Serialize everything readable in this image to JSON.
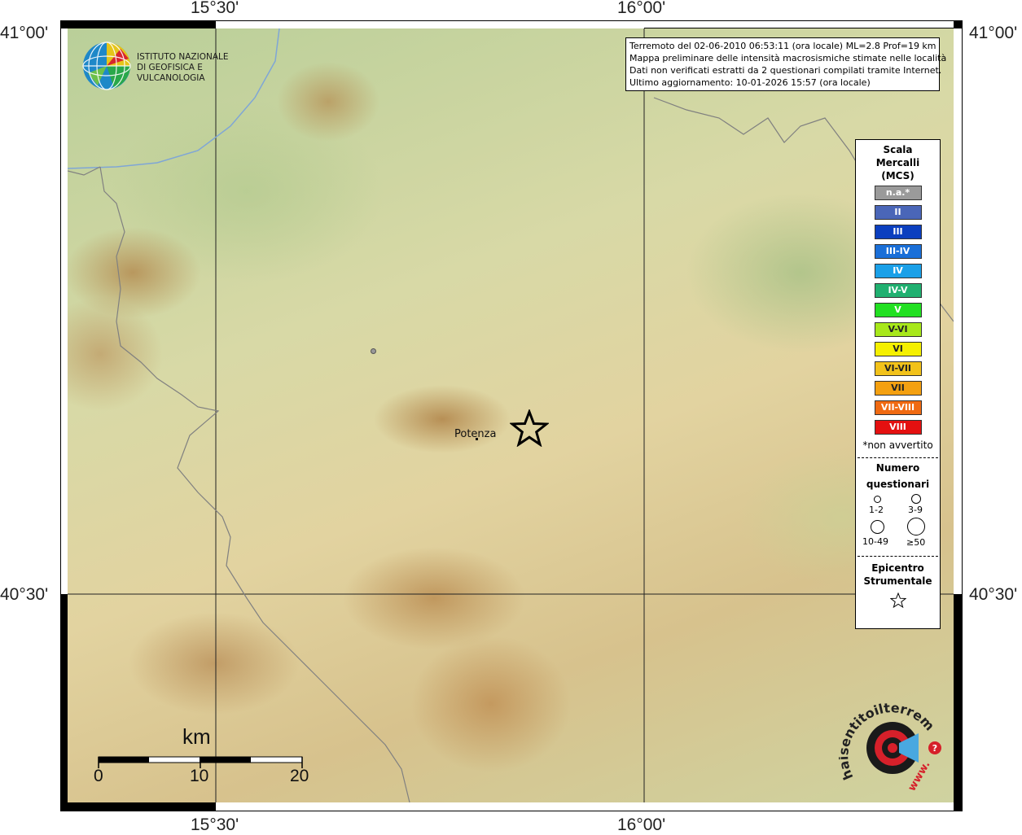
{
  "coords": {
    "top": [
      "15°30'",
      "16°00'"
    ],
    "bottom": [
      "15°30'",
      "16°00'"
    ],
    "left": [
      "41°00'",
      "40°30'"
    ],
    "right": [
      "41°00'",
      "40°30'"
    ]
  },
  "info": {
    "line1": "Terremoto del 02-06-2010 06:53:11 (ora locale) ML=2.8 Prof=19 km",
    "line2": "Mappa preliminare delle intensità macrosismiche stimate nelle località",
    "line3": "Dati non verificati estratti da 2 questionari compilati tramite Internet.",
    "line4": "Ultimo aggiornamento: 10-01-2026 15:57 (ora locale)"
  },
  "logo": {
    "line1": "ISTITUTO NAZIONALE",
    "line2": "DI GEOFISICA E VULCANOLOGIA"
  },
  "legend": {
    "title_lines": [
      "Scala",
      "Mercalli",
      "(MCS)"
    ],
    "levels": [
      {
        "label": "n.a.*",
        "color": "#9a9a9a"
      },
      {
        "label": "II",
        "color": "#4a66b8"
      },
      {
        "label": "III",
        "color": "#0b3fbf"
      },
      {
        "label": "III-IV",
        "color": "#1a6fd8"
      },
      {
        "label": "IV",
        "color": "#1aa0e8"
      },
      {
        "label": "IV-V",
        "color": "#20b070"
      },
      {
        "label": "V",
        "color": "#22e022"
      },
      {
        "label": "V-VI",
        "color": "#a8e81a"
      },
      {
        "label": "VI",
        "color": "#f5f000"
      },
      {
        "label": "VI-VII",
        "color": "#f2c21a"
      },
      {
        "label": "VII",
        "color": "#f4a010"
      },
      {
        "label": "VII-VIII",
        "color": "#f06a12"
      },
      {
        "label": "VIII",
        "color": "#e41010"
      }
    ],
    "note": "*non avvertito",
    "questionnaires_title_1": "Numero",
    "questionnaires_title_2": "questionari",
    "sizes": [
      "1-2",
      "3-9",
      "10-49",
      "≥50"
    ],
    "epicenter_title_1": "Epicentro",
    "epicenter_title_2": "Strumentale"
  },
  "places": {
    "potenza": "Potenza"
  },
  "scale_bar": {
    "unit": "km",
    "ticks": [
      "0",
      "10",
      "20"
    ]
  },
  "brand": {
    "text": "haisentitoilterremoto.it",
    "prefix": "www."
  }
}
